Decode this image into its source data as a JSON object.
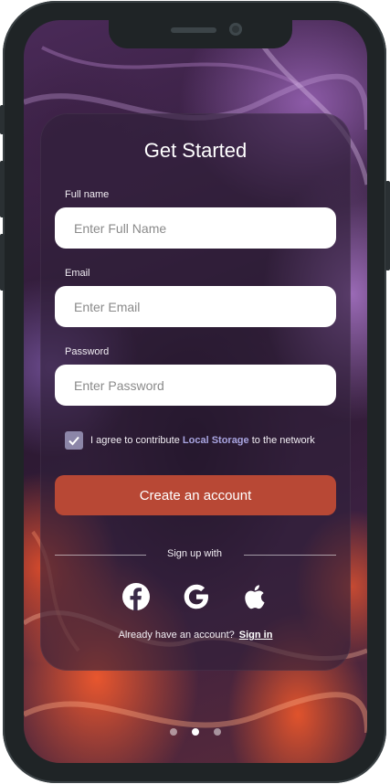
{
  "form": {
    "title": "Get Started",
    "full_name_label": "Full name",
    "full_name_placeholder": "Enter Full Name",
    "email_label": "Email",
    "email_placeholder": "Enter Email",
    "password_label": "Password",
    "password_placeholder": "Enter Password",
    "agree_checked": true,
    "agree_prefix": "I agree to contribute ",
    "agree_highlight": "Local Storage",
    "agree_suffix": " to the network",
    "create_button": "Create an account",
    "signup_with": "Sign up with",
    "already_text": "Already have an account?",
    "sign_in_link": "Sign in"
  },
  "social": [
    "facebook-icon",
    "google-icon",
    "apple-icon"
  ],
  "pager": {
    "count": 3,
    "active": 1
  },
  "colors": {
    "accent": "#b84835",
    "checkbox": "#8c86a8",
    "highlight": "#a8a4e0"
  }
}
